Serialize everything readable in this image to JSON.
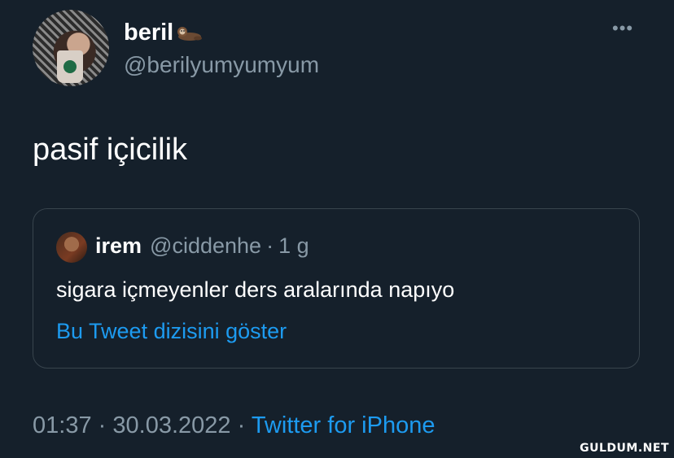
{
  "tweet": {
    "author_name": "beril",
    "author_emoji_icon": "otter-icon",
    "author_handle": "@berilyumyumyum",
    "more_icon": "more-icon",
    "text": "pasif içicilik",
    "quote": {
      "author_name": "irem",
      "author_handle": "@ciddenhe",
      "separator": "·",
      "time": "1 g",
      "text": "sigara içmeyenler ders aralarında napıyo",
      "thread_link": "Bu Tweet dizisini göster"
    },
    "meta": {
      "time": "01:37",
      "separator": "·",
      "date": "30.03.2022",
      "source": "Twitter for iPhone"
    }
  },
  "watermark": "GULDUM.NET",
  "colors": {
    "background": "#15202b",
    "secondary_text": "#8899a6",
    "link": "#1d9bf0",
    "border": "#38444d"
  }
}
